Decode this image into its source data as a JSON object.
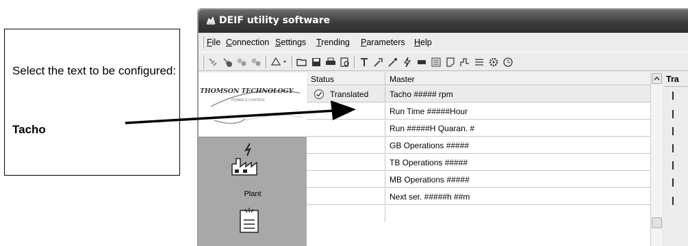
{
  "callout": {
    "instruction": "Select the text to be configured:",
    "target": "Tacho"
  },
  "window": {
    "title": "DEIF utility software"
  },
  "menu": [
    {
      "pre": "",
      "key": "F",
      "post": "ile"
    },
    {
      "pre": "",
      "key": "C",
      "post": "onnection"
    },
    {
      "pre": "",
      "key": "S",
      "post": "ettings"
    },
    {
      "pre": "",
      "key": "T",
      "post": "rending"
    },
    {
      "pre": "",
      "key": "P",
      "post": "arameters"
    },
    {
      "pre": "",
      "key": "H",
      "post": "elp"
    }
  ],
  "nav": {
    "logo": "THOMSON TECHNOLOGY",
    "logo_sub": "POWER & CONTROL",
    "plant_label": "Plant"
  },
  "grid": {
    "header_status": "Status",
    "header_master": "Master",
    "rows": [
      {
        "status": "Translated",
        "master": "Tacho     ##### rpm"
      },
      {
        "status": "",
        "master": "Run Time  #####Hour"
      },
      {
        "status": "",
        "master": "Run #####H Quaran. #"
      },
      {
        "status": "",
        "master": "GB Operations #####"
      },
      {
        "status": "",
        "master": "TB Operations #####"
      },
      {
        "status": "",
        "master": "MB Operations #####"
      },
      {
        "status": "",
        "master": "Next ser. #####h ##m"
      }
    ]
  },
  "side": {
    "header": "Tra"
  }
}
